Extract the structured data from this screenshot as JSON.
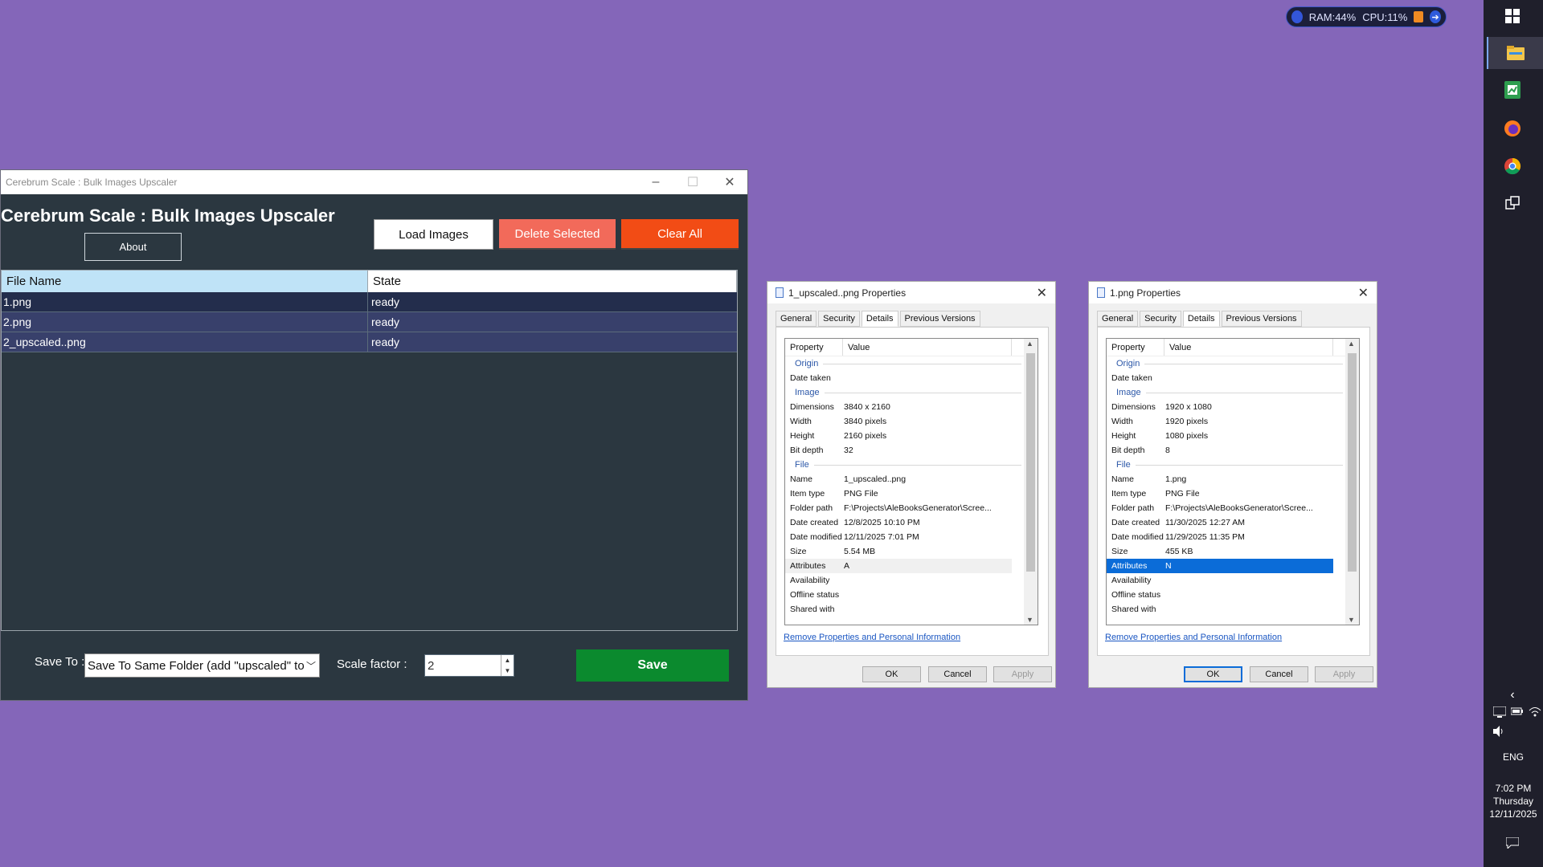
{
  "widget": {
    "ram": "RAM:44%",
    "cpu": "CPU:11%"
  },
  "app": {
    "window_title": "Cerebrum Scale : Bulk Images Upscaler",
    "heading": "Cerebrum Scale : Bulk Images Upscaler",
    "about_label": "About",
    "load_label": "Load Images",
    "delete_label": "Delete Selected",
    "clear_label": "Clear All",
    "columns": {
      "file": "File Name",
      "state": "State"
    },
    "rows": [
      {
        "file": "1.png",
        "state": "ready"
      },
      {
        "file": "2.png",
        "state": "ready"
      },
      {
        "file": "2_upscaled..png",
        "state": "ready"
      }
    ],
    "save_to_label": "Save To :",
    "save_to_value": "Save To Same Folder (add \"upscaled\" to",
    "scale_label": "Scale factor :",
    "scale_value": "2",
    "save_label": "Save"
  },
  "dialogs": [
    {
      "title": "1_upscaled..png Properties",
      "tabs": [
        "General",
        "Security",
        "Details",
        "Previous Versions"
      ],
      "head_property": "Property",
      "head_value": "Value",
      "group_origin": "Origin",
      "date_taken": "Date taken",
      "group_image": "Image",
      "dimensions_label": "Dimensions",
      "dimensions": "3840 x 2160",
      "width_label": "Width",
      "width": "3840 pixels",
      "height_label": "Height",
      "height": "2160 pixels",
      "bitdepth_label": "Bit depth",
      "bitdepth": "32",
      "group_file": "File",
      "name_label": "Name",
      "name": "1_upscaled..png",
      "type_label": "Item type",
      "type": "PNG File",
      "folder_label": "Folder path",
      "folder": "F:\\Projects\\AleBooksGenerator\\Scree...",
      "created_label": "Date created",
      "created": "12/8/2025 10:10 PM",
      "modified_label": "Date modified",
      "modified": "12/11/2025 7:01 PM",
      "size_label": "Size",
      "size": "5.54 MB",
      "attributes_label": "Attributes",
      "attributes": "A",
      "availability_label": "Availability",
      "offline_label": "Offline status",
      "shared_label": "Shared with",
      "remove_link": "Remove Properties and Personal Information",
      "ok": "OK",
      "cancel": "Cancel",
      "apply": "Apply"
    },
    {
      "title": "1.png Properties",
      "tabs": [
        "General",
        "Security",
        "Details",
        "Previous Versions"
      ],
      "head_property": "Property",
      "head_value": "Value",
      "group_origin": "Origin",
      "date_taken": "Date taken",
      "group_image": "Image",
      "dimensions_label": "Dimensions",
      "dimensions": "1920 x 1080",
      "width_label": "Width",
      "width": "1920 pixels",
      "height_label": "Height",
      "height": "1080 pixels",
      "bitdepth_label": "Bit depth",
      "bitdepth": "8",
      "group_file": "File",
      "name_label": "Name",
      "name": "1.png",
      "type_label": "Item type",
      "type": "PNG File",
      "folder_label": "Folder path",
      "folder": "F:\\Projects\\AleBooksGenerator\\Scree...",
      "created_label": "Date created",
      "created": "11/30/2025 12:27 AM",
      "modified_label": "Date modified",
      "modified": "11/29/2025 11:35 PM",
      "size_label": "Size",
      "size": "455 KB",
      "attributes_label": "Attributes",
      "attributes": "N",
      "availability_label": "Availability",
      "offline_label": "Offline status",
      "shared_label": "Shared with",
      "remove_link": "Remove Properties and Personal Information",
      "ok": "OK",
      "cancel": "Cancel",
      "apply": "Apply"
    }
  ],
  "taskbar": {
    "language": "ENG",
    "time": "7:02 PM",
    "day": "Thursday",
    "date": "12/11/2025"
  }
}
